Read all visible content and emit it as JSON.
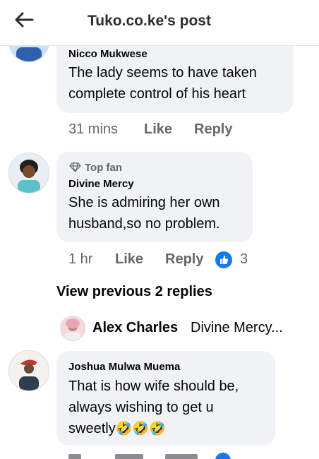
{
  "header": {
    "title": "Tuko.co.ke's post",
    "back_icon": "arrow-left-icon"
  },
  "comments": [
    {
      "author": "Nicco Mukwese",
      "lines": [
        "The lady seems to have taken",
        "complete control of his heart"
      ],
      "time": "31 mins",
      "like_label": "Like",
      "reply_label": "Reply"
    },
    {
      "badge": "Top fan",
      "author": "Divine Mercy",
      "lines": [
        "She is admiring her own",
        "husband,so no problem."
      ],
      "time": "1 hr",
      "like_label": "Like",
      "reply_label": "Reply",
      "reaction_count": "3"
    },
    {
      "author": "Joshua Mulwa Muema",
      "lines": [
        "That is how wife should be,",
        "always wishing to get u",
        "sweetly"
      ],
      "emoji": "🤣🤣🤣"
    }
  ],
  "view_previous": "View previous 2 replies",
  "reply_preview": {
    "author": "Alex Charles",
    "snippet": "Divine Mercy..."
  },
  "colors": {
    "accent": "#1877f2",
    "bubble": "#f0f2f5",
    "meta": "#65676b"
  }
}
